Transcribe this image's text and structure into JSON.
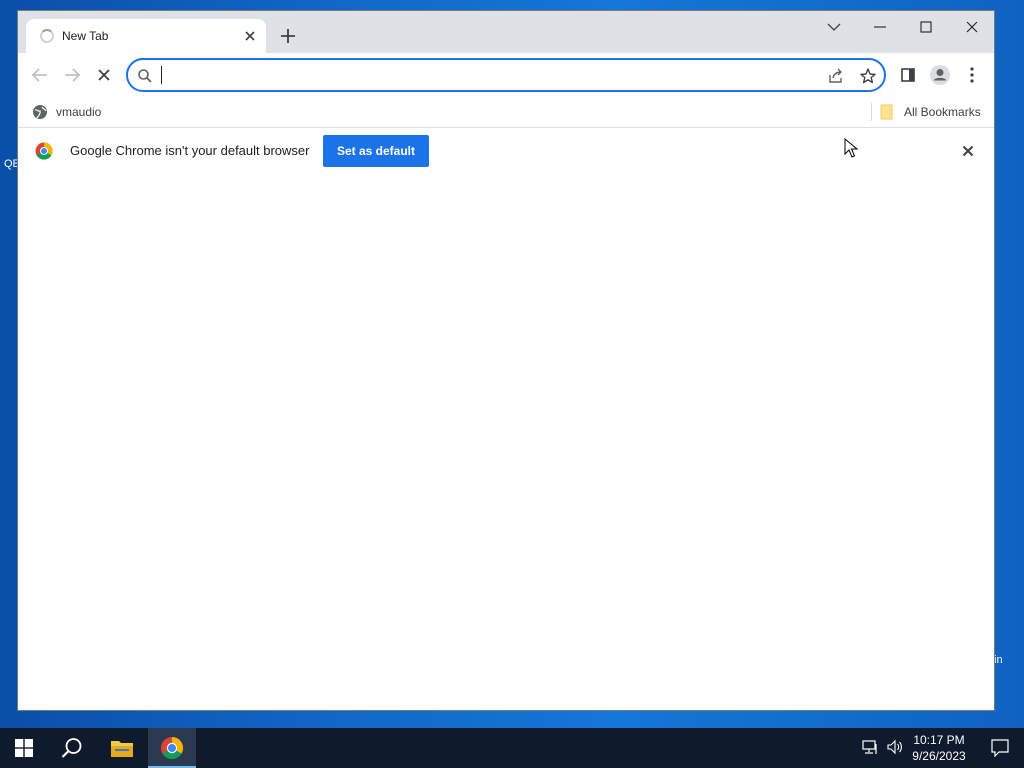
{
  "browser": {
    "tab": {
      "title": "New Tab",
      "loading": true
    },
    "window_controls": [
      "tab-search-icon",
      "minimize-icon",
      "maximize-icon",
      "close-icon"
    ],
    "omnibox": {
      "value": "",
      "placeholder": ""
    },
    "bookmarks": [
      {
        "label": "vmaudio",
        "icon": "globe-icon"
      }
    ],
    "all_bookmarks_label": "All Bookmarks",
    "infobar": {
      "message": "Google Chrome isn't your default browser",
      "button_label": "Set as default"
    }
  },
  "desktop": {
    "fragment_left": "QE",
    "fragment_right": "in"
  },
  "taskbar": {
    "clock_time": "10:17 PM",
    "clock_date": "9/26/2023"
  },
  "colors": {
    "accent": "#1a73e8",
    "tabstrip": "#dee1e6",
    "taskbar": "#0f1b2d",
    "desktop": "#1269c9"
  }
}
